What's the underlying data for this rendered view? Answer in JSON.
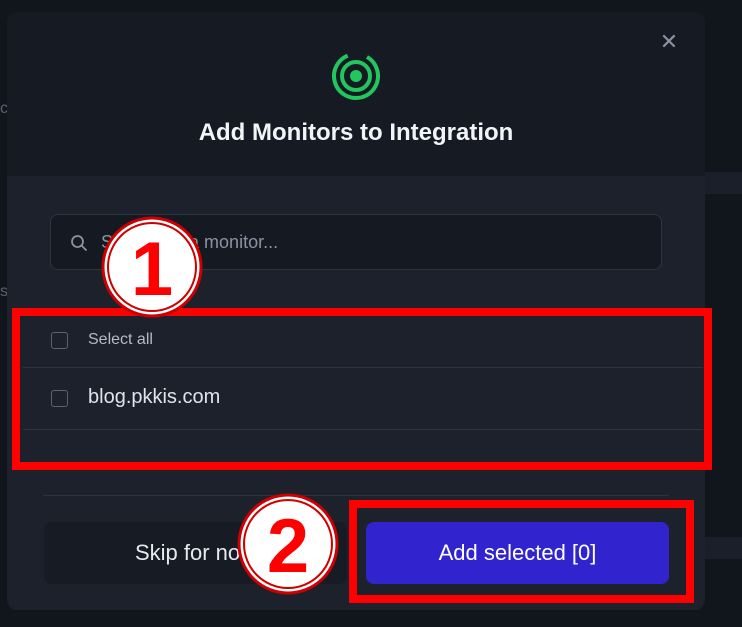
{
  "modal": {
    "close_symbol": "✕",
    "title": "Add Monitors to Integration",
    "logo_icon": "radar-target-icon",
    "accent_color": "#22c55e"
  },
  "search": {
    "placeholder": "Search for a monitor..."
  },
  "list": {
    "select_all_label": "Select all",
    "items": [
      {
        "label": "blog.pkkis.com"
      }
    ]
  },
  "footer": {
    "skip_label": "Skip for now",
    "add_label": "Add selected [0]",
    "add_color": "#3124cf"
  },
  "annotations": {
    "badge_1": "1",
    "badge_2": "2",
    "highlight_color": "#ff0000"
  }
}
